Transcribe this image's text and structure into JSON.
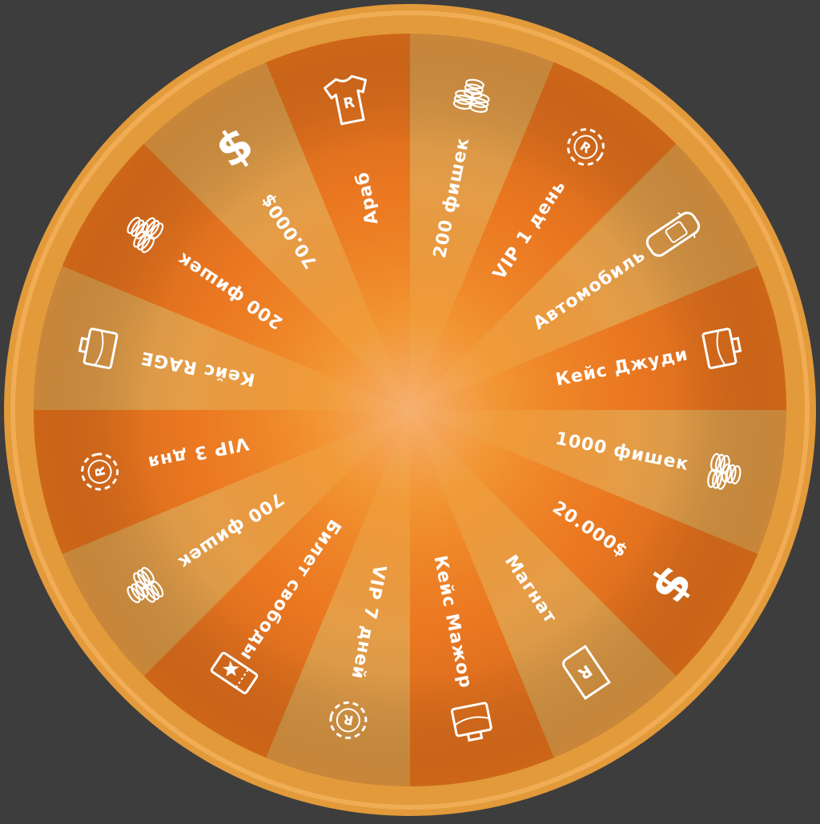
{
  "colors": {
    "background": "#3d3d3d",
    "rim": "#e39a3a",
    "rim_light": "#f3b35a",
    "segment_dark": "#e9741f",
    "segment_light": "#e2a04c",
    "center_glow": "#f5ab5e",
    "label": "#ffffff"
  },
  "wheel": {
    "segments": [
      {
        "label": "200 фишек",
        "icon": "chips-stack-icon"
      },
      {
        "label": "VIP 1 день",
        "icon": "vip-chip-icon"
      },
      {
        "label": "Автомобиль",
        "icon": "car-icon"
      },
      {
        "label": "Кейс Джуди",
        "icon": "case-icon"
      },
      {
        "label": "1000 фишек",
        "icon": "chips-stack-icon"
      },
      {
        "label": "20.000$",
        "icon": "dollar-icon"
      },
      {
        "label": "Магнат",
        "icon": "scroll-icon"
      },
      {
        "label": "Кейс Мажор",
        "icon": "case-icon"
      },
      {
        "label": "VIP 7 дней",
        "icon": "vip-chip-icon"
      },
      {
        "label": "Билет свободы",
        "icon": "ticket-icon"
      },
      {
        "label": "700 фишек",
        "icon": "chips-stack-icon"
      },
      {
        "label": "VIP 3 дня",
        "icon": "vip-chip-icon"
      },
      {
        "label": "Кейс RAGE",
        "icon": "case-icon"
      },
      {
        "label": "200 фишек",
        "icon": "chips-stack-icon"
      },
      {
        "label": "70.000$",
        "icon": "dollar-icon"
      },
      {
        "label": "Араб",
        "icon": "tshirt-icon"
      }
    ]
  }
}
